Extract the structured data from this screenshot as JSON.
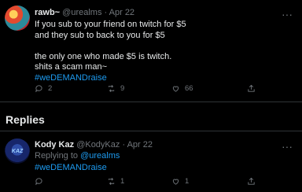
{
  "tweet": {
    "name": "rawb~",
    "handle": "@urealms",
    "date": "· Apr 22",
    "lines": [
      "If you sub to your friend on twitch for $5",
      "and they sub to back to you for $5",
      "",
      "the only one who made $5 is twitch.",
      "shits a scam man~"
    ],
    "hashtag": "#weDEMANDraise",
    "counts": {
      "replies": "2",
      "retweets": "9",
      "likes": "66"
    }
  },
  "replies_heading": "Replies",
  "reply": {
    "name": "Kody Kaz",
    "handle": "@KodyKaz",
    "date": "· Apr 22",
    "replying_prefix": "Replying to",
    "replying_to": "@urealms",
    "hashtag": "#weDEMANDraise",
    "counts": {
      "retweets": "1",
      "likes": "1"
    },
    "avatar_text": "KAZ"
  },
  "colors": {
    "background": "#000000",
    "link": "#1d9bf0",
    "muted": "#71767b"
  },
  "icons": [
    "more-icon",
    "reply-icon",
    "retweet-icon",
    "like-icon",
    "share-icon"
  ]
}
